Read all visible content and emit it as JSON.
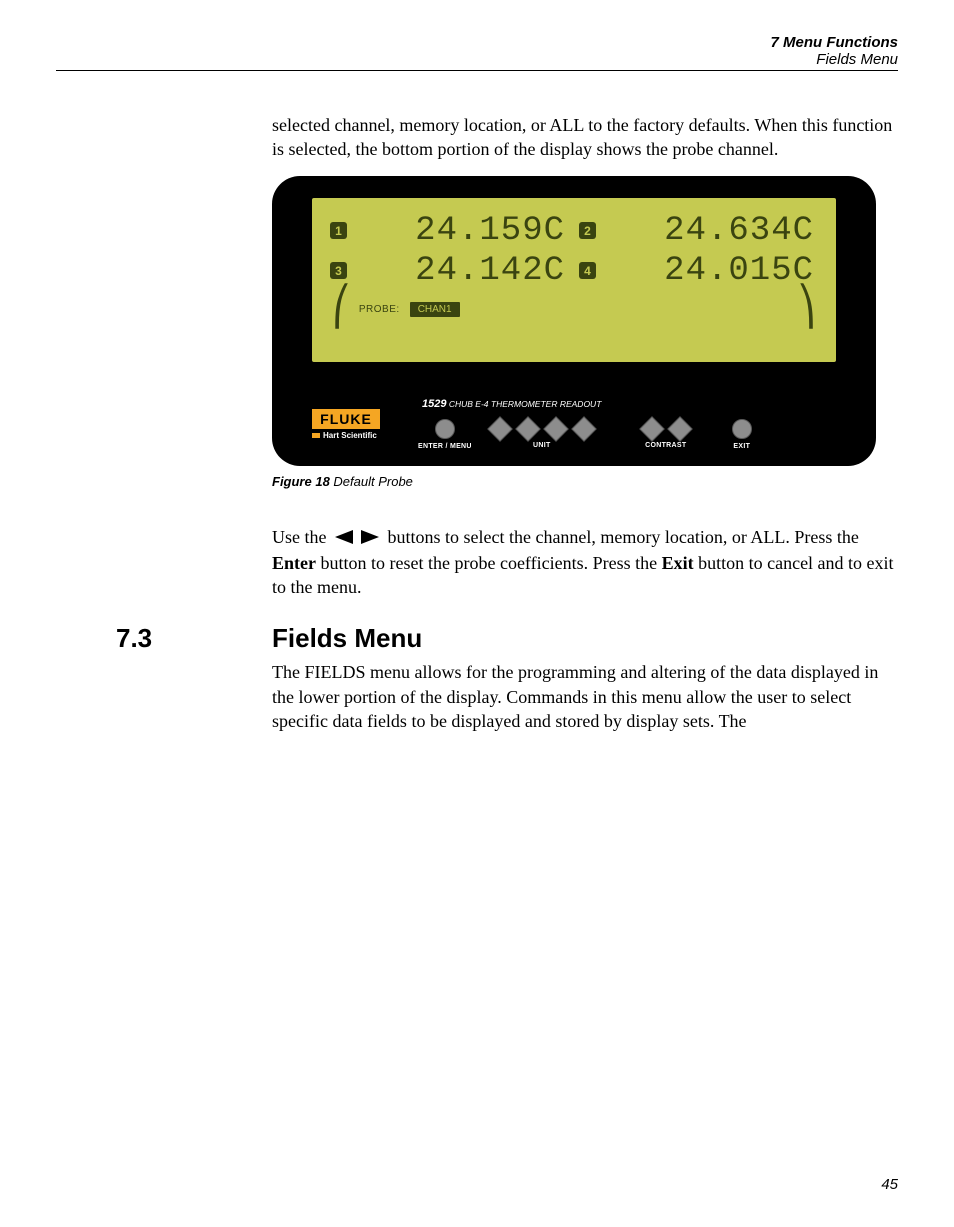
{
  "header": {
    "chapter": "7  Menu Functions",
    "section": "Fields Menu"
  },
  "para1": "selected channel, memory location, or ALL to the factory defaults. When this function is selected, the bottom portion of the display shows the probe channel.",
  "device": {
    "readings": [
      {
        "ch": "1",
        "value": "24.159C"
      },
      {
        "ch": "2",
        "value": "24.634C"
      },
      {
        "ch": "3",
        "value": "24.142C"
      },
      {
        "ch": "4",
        "value": "24.015C"
      }
    ],
    "probe_label": "PROBE:",
    "probe_value": "CHAN1",
    "brand": "FLUKE",
    "subbrand": "Hart Scientific",
    "model_num": "1529",
    "model_text": " CHUB E-4 THERMOMETER READOUT",
    "buttons": {
      "enter": "ENTER / MENU",
      "unit": "UNIT",
      "contrast": "CONTRAST",
      "exit": "EXIT"
    }
  },
  "figure_caption": {
    "bold": "Figure 18",
    "text": "   Default Probe"
  },
  "para2_a": "Use the ",
  "para2_b": " buttons to select the channel, memory location, or ALL. Press the ",
  "para2_c": " button to reset the probe coefficients. Press the ",
  "para2_d": " button to cancel and to exit to the menu.",
  "enter_word": "Enter",
  "exit_word": "Exit",
  "section": {
    "num": "7.3",
    "title": "Fields Menu"
  },
  "para3": "The FIELDS menu allows for the programming and altering of the data displayed in the lower portion of the display. Commands in this menu allow the user to select specific data fields to be displayed and stored by display sets. The",
  "page_number": "45"
}
